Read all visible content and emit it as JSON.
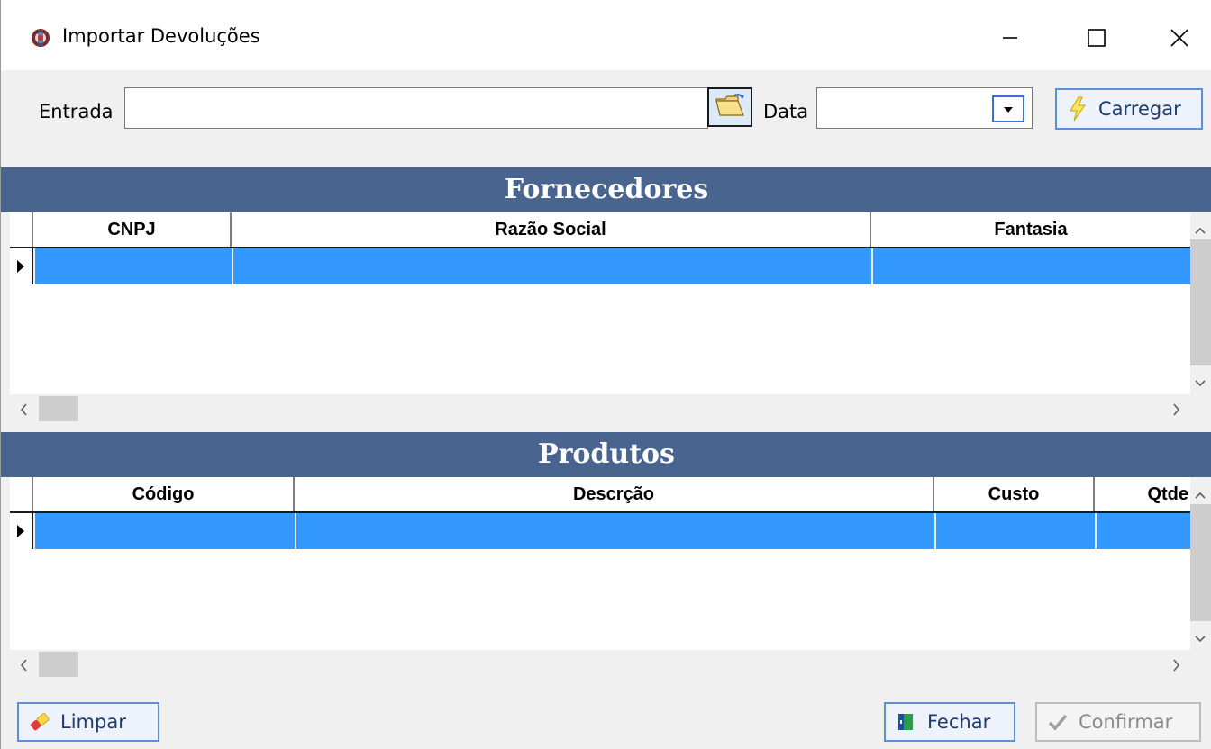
{
  "window": {
    "title": "Importar Devoluções",
    "minimize_glyph": "—",
    "maximize_glyph": "☐",
    "close_glyph": "✕"
  },
  "toolbar": {
    "entrada_label": "Entrada",
    "entrada_value": "",
    "data_label": "Data",
    "data_value": "",
    "carregar_label": "Carregar"
  },
  "fornecedores": {
    "title": "Fornecedores",
    "columns": [
      "CNPJ",
      "Razão Social",
      "Fantasia"
    ],
    "rows": [
      [
        "",
        "",
        ""
      ]
    ]
  },
  "produtos": {
    "title": "Produtos",
    "columns": [
      "Código",
      "Descrção",
      "Custo",
      "Qtde"
    ],
    "rows": [
      [
        "",
        "",
        "",
        ""
      ]
    ]
  },
  "footer": {
    "limpar_label": "Limpar",
    "fechar_label": "Fechar",
    "confirmar_label": "Confirmar"
  },
  "icons": {
    "app": "app-icon",
    "folder": "folder-open-icon",
    "dropdown": "chevron-down-icon",
    "carregar": "lightning-icon",
    "limpar": "eraser-icon",
    "fechar": "door-exit-icon",
    "confirmar": "checkmark-icon"
  },
  "colors": {
    "band": "#4a6490",
    "selected_row": "#3399ff",
    "button_text": "#1f3b6e",
    "button_border": "#5b8fd6",
    "disabled_text": "#8a8a8a"
  }
}
